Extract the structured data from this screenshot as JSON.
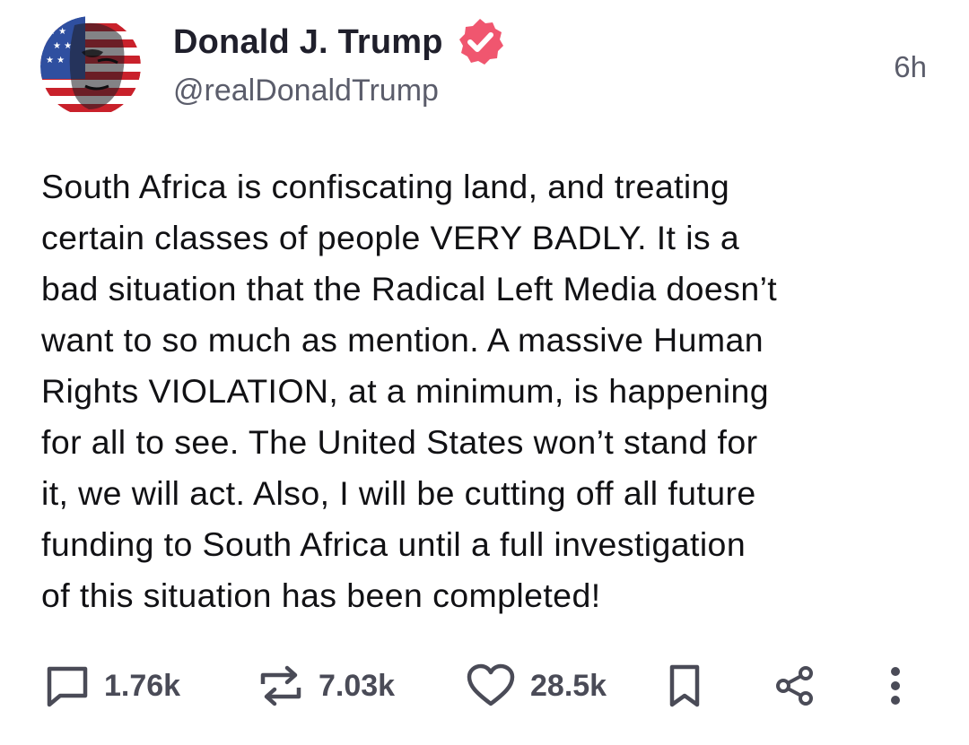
{
  "author": {
    "display_name": "Donald J. Trump",
    "handle": "@realDonaldTrump",
    "verified": true,
    "verified_badge_color": "#f0566f",
    "avatar_icon": "flag-face-avatar"
  },
  "post": {
    "timestamp": "6h",
    "lines": [
      "South Africa is confiscating land, and treating",
      "certain classes of people VERY BADLY. It is a",
      "bad situation that the Radical Left Media doesn’t",
      "want to so much as mention. A massive Human",
      "Rights VIOLATION, at a minimum, is happening",
      "for all to see. The United States won’t stand for",
      "it, we will act. Also, I will be cutting off all future",
      "funding to South Africa until a full investigation",
      "of this situation has been completed!"
    ]
  },
  "actions": {
    "replies": {
      "icon": "reply-icon",
      "count": "1.76k"
    },
    "retruths": {
      "icon": "retruth-icon",
      "count": "7.03k"
    },
    "likes": {
      "icon": "heart-icon",
      "count": "28.5k"
    },
    "bookmark": {
      "icon": "bookmark-icon"
    },
    "share": {
      "icon": "share-icon"
    },
    "more": {
      "icon": "more-vertical-icon"
    }
  },
  "colors": {
    "text": "#111114",
    "muted": "#5b5d6b",
    "icon": "#4a4b57",
    "accent": "#f0566f"
  }
}
